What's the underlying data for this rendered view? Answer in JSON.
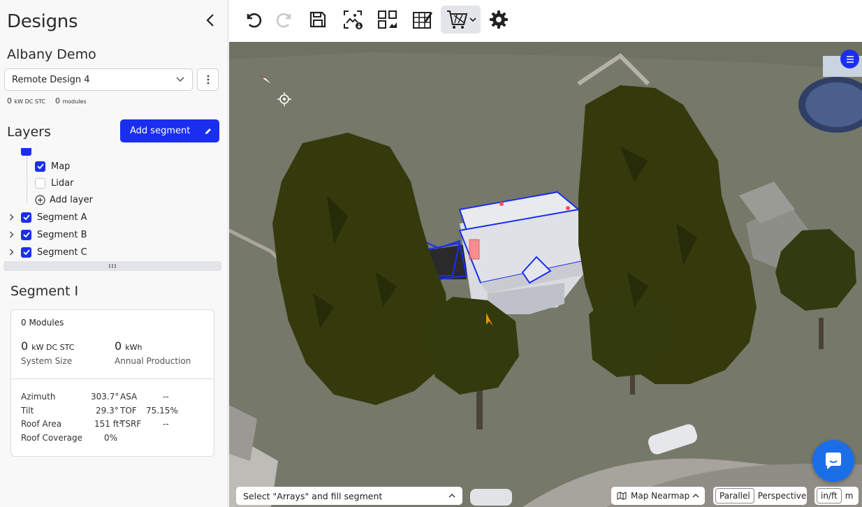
{
  "sidebar": {
    "title": "Designs",
    "project_name": "Albany Demo",
    "design_select": {
      "value": "Remote Design 4"
    },
    "stats": {
      "kw_value": "0",
      "kw_unit": "kW DC STC",
      "modules_value": "0",
      "modules_unit": "modules"
    },
    "layers_title": "Layers",
    "add_segment_label": "Add segment",
    "layers": [
      {
        "label": "Map",
        "checked": true
      },
      {
        "label": "Lidar",
        "checked": false
      },
      {
        "label": "Add layer"
      }
    ],
    "segments": [
      {
        "label": "Segment A",
        "checked": true
      },
      {
        "label": "Segment B",
        "checked": true
      },
      {
        "label": "Segment C",
        "checked": true
      }
    ],
    "segment_detail": {
      "title": "Segment I",
      "modules": "0 Modules",
      "system_size": {
        "value": "0",
        "unit": "kW DC STC",
        "caption": "System Size"
      },
      "annual_production": {
        "value": "0",
        "unit": "kWh",
        "caption": "Annual Production"
      },
      "properties": [
        {
          "label": "Azimuth",
          "value": "303.7°",
          "label2": "ASA",
          "value2": "--"
        },
        {
          "label": "Tilt",
          "value": "29.3°",
          "label2": "TOF",
          "value2": "75.15%"
        },
        {
          "label": "Roof Area",
          "value": "151 ft²",
          "label2": "TSRF",
          "value2": "--"
        },
        {
          "label": "Roof Coverage",
          "value": "0%",
          "label2": "",
          "value2": ""
        }
      ]
    }
  },
  "toolbar": {
    "buttons": [
      "undo-icon",
      "redo-icon",
      "save-icon",
      "image-download-icon",
      "layout-grid-icon",
      "edit-table-icon",
      "shopping-cart-icon",
      "gear-icon"
    ],
    "active_button": "shopping-cart-icon"
  },
  "map": {
    "hint_select": {
      "value": "Select \"Arrays\" and fill segment"
    },
    "map_source": {
      "value": "Map Nearmap"
    },
    "projection": {
      "options": [
        "Parallel",
        "Perspective"
      ],
      "selected": "Parallel"
    },
    "units": {
      "options": [
        "in/ft",
        "m"
      ],
      "selected": "in/ft"
    }
  },
  "colors": {
    "accent": "#1a2ef0",
    "tree": "#343a0c",
    "roof_outline": "#1a2ef0",
    "chat": "#1a6fe8"
  }
}
